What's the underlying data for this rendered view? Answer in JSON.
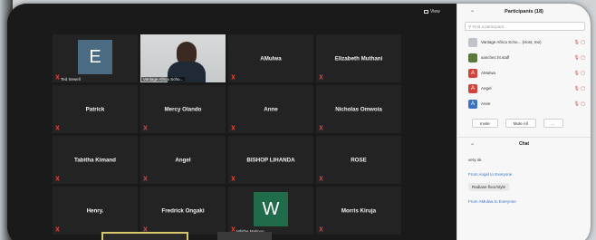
{
  "view_label": "View",
  "tiles": [
    {
      "type": "avatar",
      "letter": "E",
      "color": "#4a6b82",
      "caption": "Ted Sewell"
    },
    {
      "type": "video",
      "caption": "Vantage Africa Scho..."
    },
    {
      "type": "name",
      "name": "AMulwa"
    },
    {
      "type": "name",
      "name": "Elizabeth Muthani"
    },
    {
      "type": "name",
      "name": "Patrick"
    },
    {
      "type": "name",
      "name": "Mercy Olando"
    },
    {
      "type": "name",
      "name": "Anne"
    },
    {
      "type": "name",
      "name": "Nicholas Omwoia"
    },
    {
      "type": "name",
      "name": "Tabitha Kimand"
    },
    {
      "type": "name",
      "name": "Angel"
    },
    {
      "type": "name",
      "name": "BISHOP LIHANDA"
    },
    {
      "type": "name",
      "name": "ROSE"
    },
    {
      "type": "name",
      "name": "Henry."
    },
    {
      "type": "name",
      "name": "Fredrick Ongaki"
    },
    {
      "type": "avatar",
      "letter": "W",
      "color": "#1f6b4a",
      "caption": "Mbithe Malmon"
    },
    {
      "type": "name",
      "name": "Morris Kiruja"
    }
  ],
  "panel": {
    "title": "Participants (18)",
    "search_placeholder": "Find a participant",
    "participants": [
      {
        "name": "Vantage Africa Scho... (Host, me)",
        "avatar": "",
        "color": "#c0c4c8",
        "icons": "🎙 ▢"
      },
      {
        "name": "sanchez.ht.staff",
        "avatar": "",
        "color": "#5a7a3a",
        "icons": "🎙 ▢"
      },
      {
        "name": "AMulwa",
        "avatar": "A",
        "color": "#d1433b",
        "icons": "🎙 ▢"
      },
      {
        "name": "Angel",
        "avatar": "A",
        "color": "#d1433b",
        "icons": "🎙 ▢"
      },
      {
        "name": "Anne",
        "avatar": "A",
        "color": "#3b73c2",
        "icons": "🎙 ▢"
      }
    ],
    "invite_label": "Invite",
    "mute_all_label": "Mute All",
    "more_label": "...",
    "chat_title": "Chat",
    "chat_messages": [
      {
        "from": "",
        "text": "very ok"
      },
      {
        "from": "From Angel to Everyone",
        "text": "Radiase floor/style"
      },
      {
        "from": "From AMulwa to Everyone",
        "text": ""
      }
    ]
  }
}
